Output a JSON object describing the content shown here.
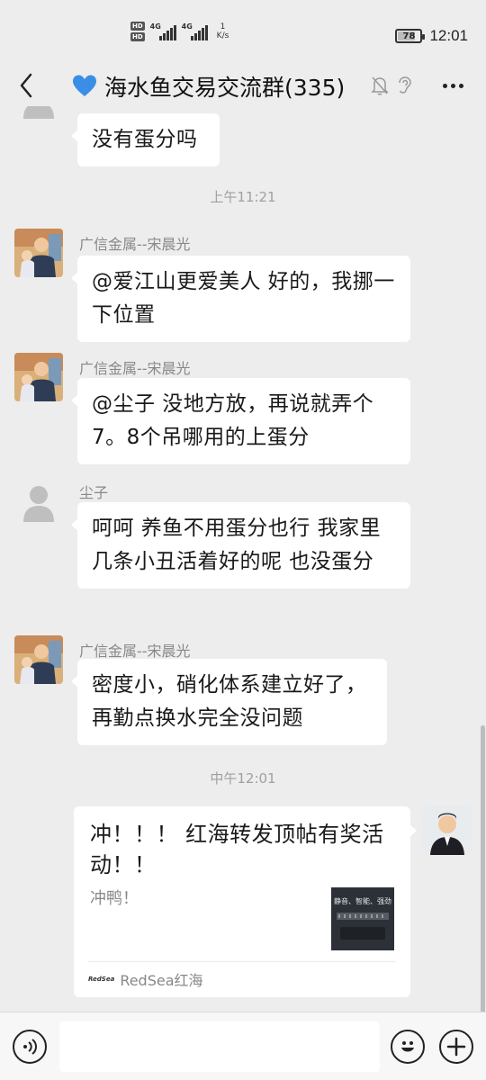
{
  "status_bar": {
    "sim1_badge": "HD",
    "sim2_badge": "HD",
    "network1": "4G",
    "network2": "4G",
    "net_speed_value": "1",
    "net_speed_unit": "K/s",
    "battery_level": "78",
    "battery_fraction": 0.78,
    "time": "12:01"
  },
  "nav": {
    "title": "海水鱼交易交流群(335)",
    "heart_color": "#3a8ee6"
  },
  "messages": [
    {
      "id": "m0",
      "sender": "",
      "text": "没有蛋分吗"
    },
    {
      "id": "m1",
      "sender": "广信金属--宋晨光",
      "text": "@爱江山更爱美人  好的，我挪一下位置"
    },
    {
      "id": "m2",
      "sender": "广信金属--宋晨光",
      "text": "@尘子  没地方放，再说就弄个7。8个吊哪用的上蛋分"
    },
    {
      "id": "m3",
      "sender": "尘子",
      "text": "呵呵  养鱼不用蛋分也行  我家里几条小丑活着好的呢  也没蛋分"
    },
    {
      "id": "m4",
      "sender": "广信金属--宋晨光",
      "text": "密度小，硝化体系建立好了，再勤点换水完全没问题"
    }
  ],
  "timestamps": {
    "t1": "上午11:21",
    "t2": "中午12:01"
  },
  "link_card": {
    "title": "冲！！！ 红海转发顶帖有奖活动！！",
    "description": "冲鸭！",
    "thumbnail_text": "静音、智能、强劲",
    "source_logo": "RedSea",
    "source": "RedSea红海"
  },
  "input": {
    "placeholder": ""
  }
}
